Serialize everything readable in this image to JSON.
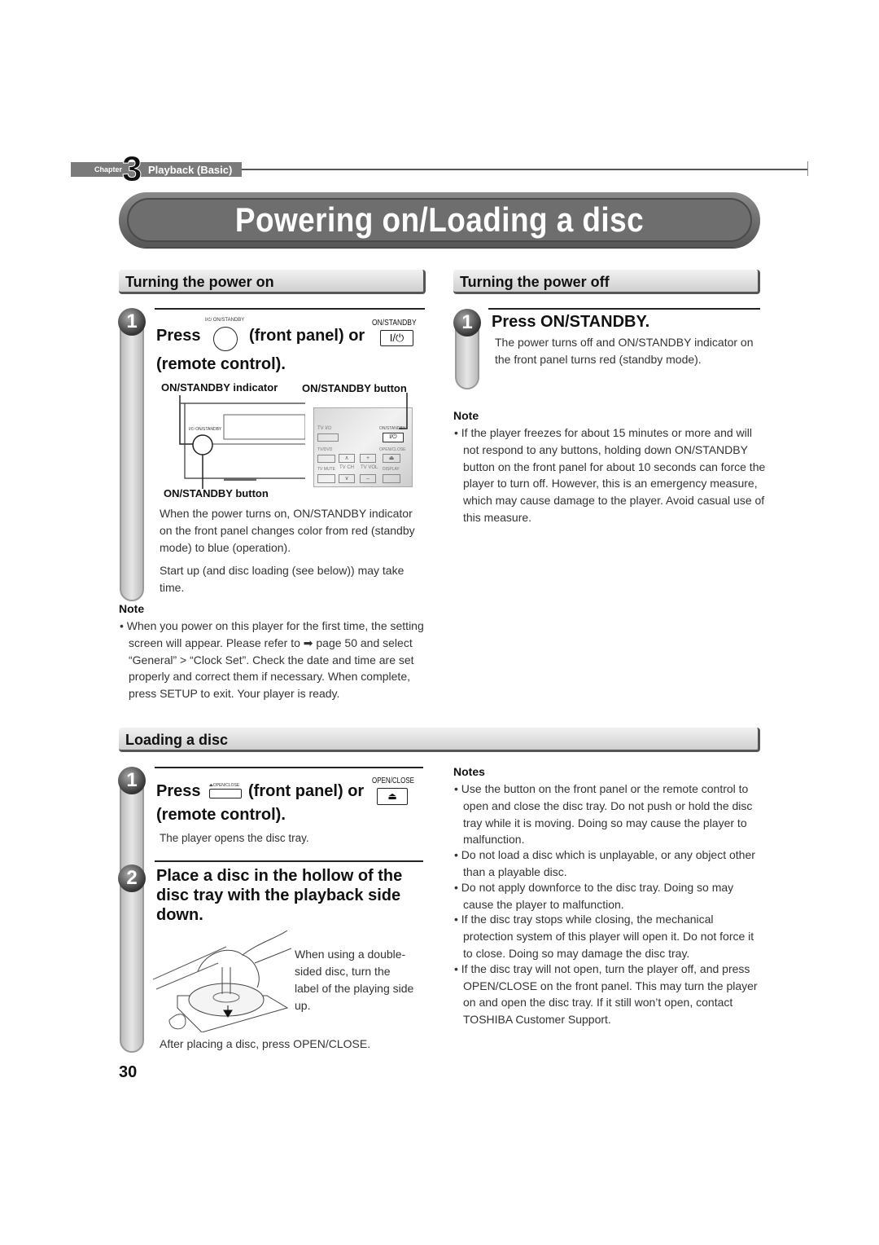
{
  "chapter": {
    "word": "Chapter",
    "number": "3",
    "title": "Playback (Basic)"
  },
  "page_title": "Powering on/Loading a disc",
  "power_on": {
    "section": "Turning the power on",
    "step": {
      "number": "1",
      "title_press": "Press",
      "title_mid": "(front panel) or",
      "title_end": "(remote control).",
      "front_button_caption": "I/⏻ ON/STANDBY",
      "remote_button_caption": "ON/STANDBY",
      "remote_button_glyph": "I/⏻",
      "figure": {
        "label_indicator": "ON/STANDBY indicator",
        "label_remote_button": "ON/STANDBY button",
        "label_front_button": "ON/STANDBY button",
        "panel_caption": "I/⏻ ON/STANDBY",
        "remote_keys": {
          "tv_power": "TV I/⏻",
          "on_standby": "ON/STANDBY",
          "on_standby_glyph": "I/⏻",
          "tv_dvd": "TV/DVD",
          "open_close": "OPEN/CLOSE",
          "tv_mute": "TV MUTE",
          "tv_ch": "TV CH",
          "tv_vol": "TV VOL",
          "display": "DISPLAY",
          "up": "∧",
          "down": "∨",
          "plus": "+",
          "minus": "–",
          "eject": "⏏"
        }
      },
      "text1": "When the power turns on, ON/STANDBY indicator on the front panel changes color from red (standby mode) to blue (operation).",
      "text2": "Start up (and disc loading (see below)) may take time."
    },
    "note_heading": "Note",
    "note": "When you power on this player for the first time, the setting screen will appear. Please refer to ➡ page 50 and select “General” > “Clock Set”. Check the date and time are set properly and correct them if necessary. When complete, press SETUP to exit. Your player is ready."
  },
  "power_off": {
    "section": "Turning the power off",
    "step": {
      "number": "1",
      "title": "Press ON/STANDBY.",
      "text": "The power turns off and ON/STANDBY indicator on the front panel turns red (standby mode)."
    },
    "note_heading": "Note",
    "note": "If the player freezes for about 15 minutes or more and will not respond to any buttons, holding down ON/STANDBY button on the front panel for about 10 seconds can force the player to turn off. However, this is an emergency measure, which may cause damage to the player. Avoid casual use of this measure."
  },
  "loading": {
    "section": "Loading a disc",
    "step1": {
      "number": "1",
      "title_press": "Press",
      "title_mid": "(front panel) or",
      "title_end": "(remote control).",
      "front_button_caption": "⏏OPEN/CLOSE",
      "remote_button_caption": "OPEN/CLOSE",
      "remote_button_glyph": "⏏",
      "text": "The player opens the disc tray."
    },
    "step2": {
      "number": "2",
      "title": "Place a disc in the hollow of the disc tray with the playback side down.",
      "figure_caption": "When using a double-sided disc, turn the label of the playing side up.",
      "after": "After placing a disc, press OPEN/CLOSE."
    },
    "notes_heading": "Notes",
    "notes": [
      "Use the button on the front panel or the remote control to open and close the disc tray. Do not push or hold the disc tray while it is moving. Doing so may cause the player to malfunction.",
      "Do not load a disc which is unplayable, or any object other than a playable disc.",
      "Do not apply downforce to the disc tray. Doing so may cause the player to malfunction.",
      "If the disc tray stops while closing, the mechanical protection system of this player will open it. Do not force it to close. Doing so may damage the disc tray.",
      "If the disc tray will not open, turn the player off, and press OPEN/CLOSE on the front panel. This may turn the player on and open the disc tray. If it still won’t open, contact TOSHIBA Customer Support."
    ]
  },
  "page_number": "30"
}
